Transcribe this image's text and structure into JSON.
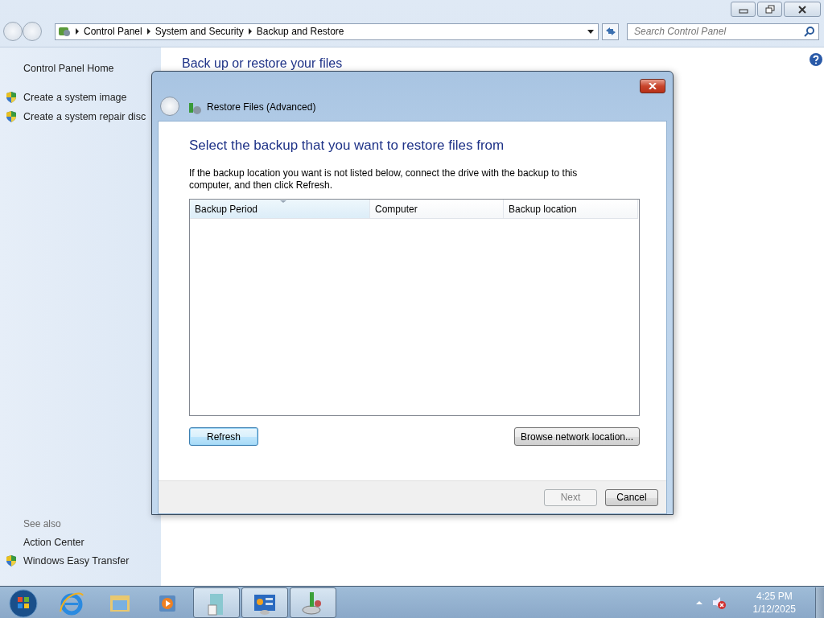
{
  "window": {
    "controls": [
      {
        "kind": "minimize"
      },
      {
        "kind": "restore"
      },
      {
        "kind": "close"
      }
    ]
  },
  "address_bar": {
    "breadcrumb": [
      "Control Panel",
      "System and Security",
      "Backup and Restore"
    ]
  },
  "search": {
    "placeholder": "Search Control Panel"
  },
  "sidebar": {
    "items": [
      {
        "label": "Control Panel Home",
        "shield": false
      },
      {
        "label": "Create a system image",
        "shield": true
      },
      {
        "label": "Create a system repair disc",
        "shield": true
      }
    ],
    "see_also": {
      "title": "See also",
      "items": [
        {
          "label": "Action Center",
          "shield": false
        },
        {
          "label": "Windows Easy Transfer",
          "shield": true
        }
      ]
    }
  },
  "content": {
    "heading": "Back up or restore your files"
  },
  "dialog": {
    "title": "Restore Files (Advanced)",
    "heading": "Select the backup that you want to restore files from",
    "instruction": "If the backup location you want is not listed below, connect the drive with the backup to this computer, and then click Refresh.",
    "table": {
      "columns": [
        {
          "label": "Backup Period",
          "sorted": true
        },
        {
          "label": "Computer",
          "sorted": false
        },
        {
          "label": "Backup location",
          "sorted": false
        }
      ]
    },
    "buttons": [
      {
        "label": "Refresh",
        "default": true,
        "disabled": false
      },
      {
        "label": "Browse network location...",
        "default": false,
        "disabled": false
      }
    ],
    "footer_buttons": [
      {
        "label": "Next",
        "default": false,
        "disabled": true
      },
      {
        "label": "Cancel",
        "default": false,
        "disabled": false
      }
    ]
  },
  "taskbar": {
    "items": [
      {
        "kind": "start"
      },
      {
        "kind": "browser",
        "running": false
      },
      {
        "kind": "folder",
        "running": false
      },
      {
        "kind": "media",
        "running": false
      },
      {
        "kind": "document",
        "running": true
      },
      {
        "kind": "control-panel",
        "running": true
      },
      {
        "kind": "backup",
        "running": true
      }
    ],
    "time": "4:25 PM",
    "date": "1/12/2025"
  }
}
